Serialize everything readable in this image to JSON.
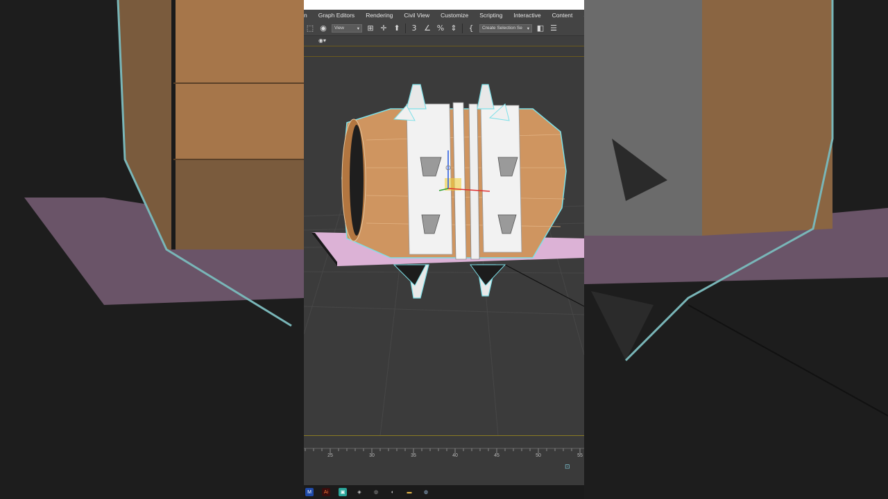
{
  "menu": {
    "items": [
      {
        "label": "n"
      },
      {
        "label": "Graph Editors"
      },
      {
        "label": "Rendering"
      },
      {
        "label": "Civil View"
      },
      {
        "label": "Customize"
      },
      {
        "label": "Scripting"
      },
      {
        "label": "Interactive"
      },
      {
        "label": "Content"
      },
      {
        "label": "S"
      }
    ]
  },
  "toolbar": {
    "view_dropdown": "View",
    "selection_set_dropdown": "Create Selection Se",
    "icons": [
      "select-region-icon",
      "selection-filter-icon",
      "move-icon",
      "snap-3-icon",
      "angle-snap-icon",
      "percent-snap-icon",
      "spinner-snap-icon",
      "edit-named-sets-icon",
      "mirror-icon",
      "align-icon"
    ]
  },
  "timeline": {
    "ticks": [
      "25",
      "30",
      "35",
      "40",
      "45",
      "50",
      "55"
    ]
  },
  "taskbar": {
    "icons": [
      "max-icon",
      "illustrator-icon",
      "app-icon",
      "blender-icon",
      "chrome-icon",
      "app-icon-2",
      "folder-icon",
      "steam-icon"
    ],
    "labels": {
      "max": "M",
      "illustrator": "Ai"
    }
  },
  "colors": {
    "barrel_wood": "#cf9560",
    "bands": "#f2f2f2",
    "selection_outline": "#7de0e8",
    "ground_plane": "#dcb2d6",
    "viewport_bg": "#3b3b3b"
  }
}
